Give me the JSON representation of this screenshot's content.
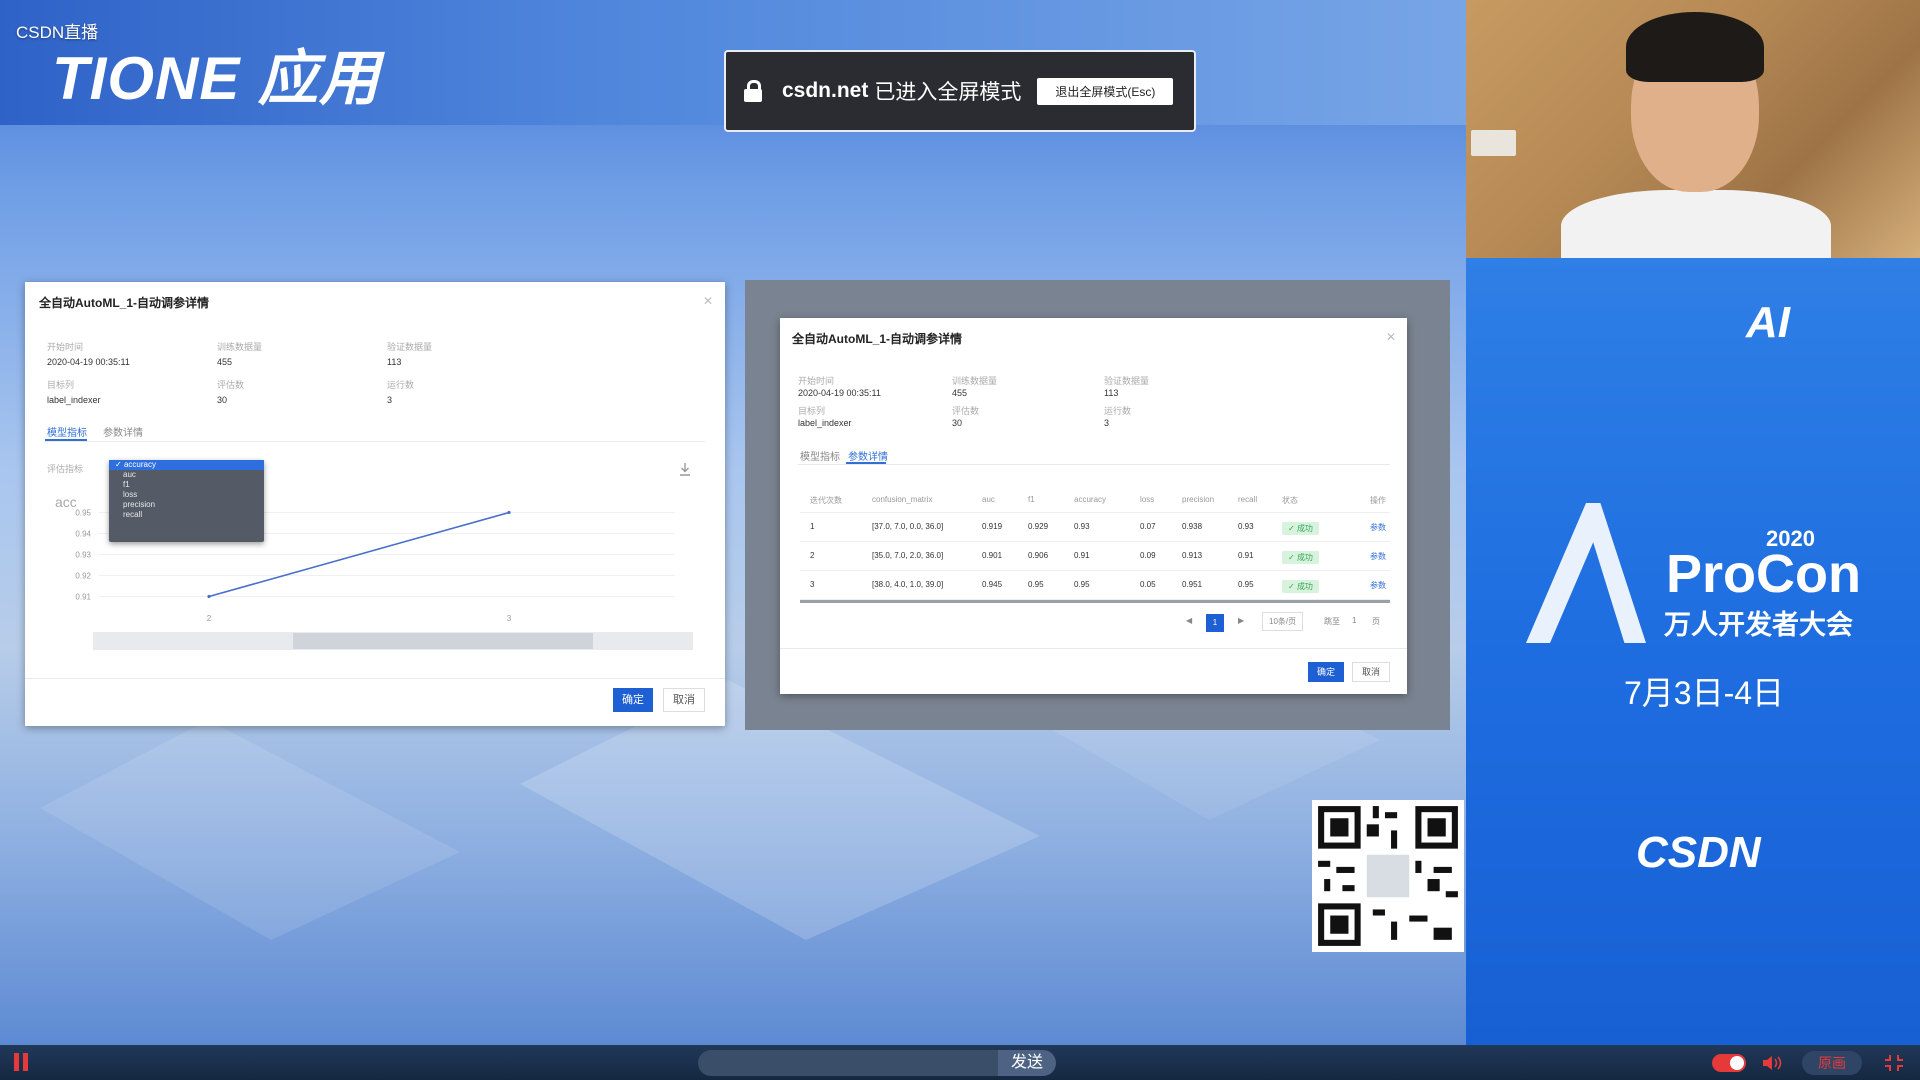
{
  "overlay": {
    "live_label": "CSDN直播"
  },
  "slide": {
    "title": "TIONE 应用"
  },
  "fullscreen_notice": {
    "domain": "csdn.net",
    "message": "已进入全屏模式",
    "exit_button": "退出全屏模式(Esc)"
  },
  "dialog_left": {
    "title": "全自动AutoML_1-自动调参详情",
    "fields": [
      {
        "label": "开始时间",
        "value": "2020-04-19 00:35:11"
      },
      {
        "label": "训练数据量",
        "value": "455"
      },
      {
        "label": "验证数据量",
        "value": "113"
      },
      {
        "label": "目标列",
        "value": "label_indexer"
      },
      {
        "label": "评估数",
        "value": "30"
      },
      {
        "label": "运行数",
        "value": "3"
      }
    ],
    "tabs": [
      {
        "label": "模型指标",
        "active": true
      },
      {
        "label": "参数详情",
        "active": false
      }
    ],
    "metric_select_label": "评估指标",
    "dropdown_options": [
      "accuracy",
      "auc",
      "f1",
      "loss",
      "precision",
      "recall"
    ],
    "selected_metric": "accuracy",
    "chart_y_label": "acc",
    "confirm_button": "确定",
    "cancel_button": "取消"
  },
  "dialog_right": {
    "title": "全自动AutoML_1-自动调参详情",
    "fields": [
      {
        "label": "开始时间",
        "value": "2020-04-19 00:35:11"
      },
      {
        "label": "训练数据量",
        "value": "455"
      },
      {
        "label": "验证数据量",
        "value": "113"
      },
      {
        "label": "目标列",
        "value": "label_indexer"
      },
      {
        "label": "评估数",
        "value": "30"
      },
      {
        "label": "运行数",
        "value": "3"
      }
    ],
    "tabs": [
      {
        "label": "模型指标",
        "active": false
      },
      {
        "label": "参数详情",
        "active": true
      }
    ],
    "table": {
      "headers": [
        "迭代次数",
        "confusion_matrix",
        "auc",
        "f1",
        "accuracy",
        "loss",
        "precision",
        "recall",
        "状态",
        "操作"
      ],
      "rows": [
        [
          "1",
          "[37.0, 7.0, 0.0, 36.0]",
          "0.919",
          "0.929",
          "0.93",
          "0.07",
          "0.938",
          "0.93",
          "成功",
          "参数"
        ],
        [
          "2",
          "[35.0, 7.0, 2.0, 36.0]",
          "0.901",
          "0.906",
          "0.91",
          "0.09",
          "0.913",
          "0.91",
          "成功",
          "参数"
        ],
        [
          "3",
          "[38.0, 4.0, 1.0, 39.0]",
          "0.945",
          "0.95",
          "0.95",
          "0.05",
          "0.951",
          "0.95",
          "成功",
          "参数"
        ]
      ]
    },
    "pagination": {
      "current_page": "1",
      "page_size": "10条/页",
      "goto_label": "跳至",
      "goto_value": "1",
      "page_unit": "页"
    },
    "confirm_button": "确定",
    "cancel_button": "取消"
  },
  "chart_data": {
    "type": "line",
    "title": "",
    "xlabel": "",
    "ylabel": "acc",
    "x": [
      2,
      3
    ],
    "y": [
      0.91,
      0.95
    ],
    "x_ticks": [
      "2",
      "3"
    ],
    "y_ticks": [
      "0.91",
      "0.92",
      "0.93",
      "0.94",
      "0.95"
    ],
    "ylim": [
      0.905,
      0.955
    ],
    "grid": true,
    "color": "#4a6fc9"
  },
  "promo": {
    "brand": "AI",
    "year": "2020",
    "name": "ProCon",
    "subtitle": "万人开发者大会",
    "date": "7月3日-4日",
    "sponsor": "CSDN"
  },
  "player": {
    "send_label": "发送",
    "quality_label": "原画"
  },
  "colors": {
    "accent_blue": "#1f5fd4",
    "live_red": "#e63a3a",
    "success_green": "#3aa659"
  }
}
